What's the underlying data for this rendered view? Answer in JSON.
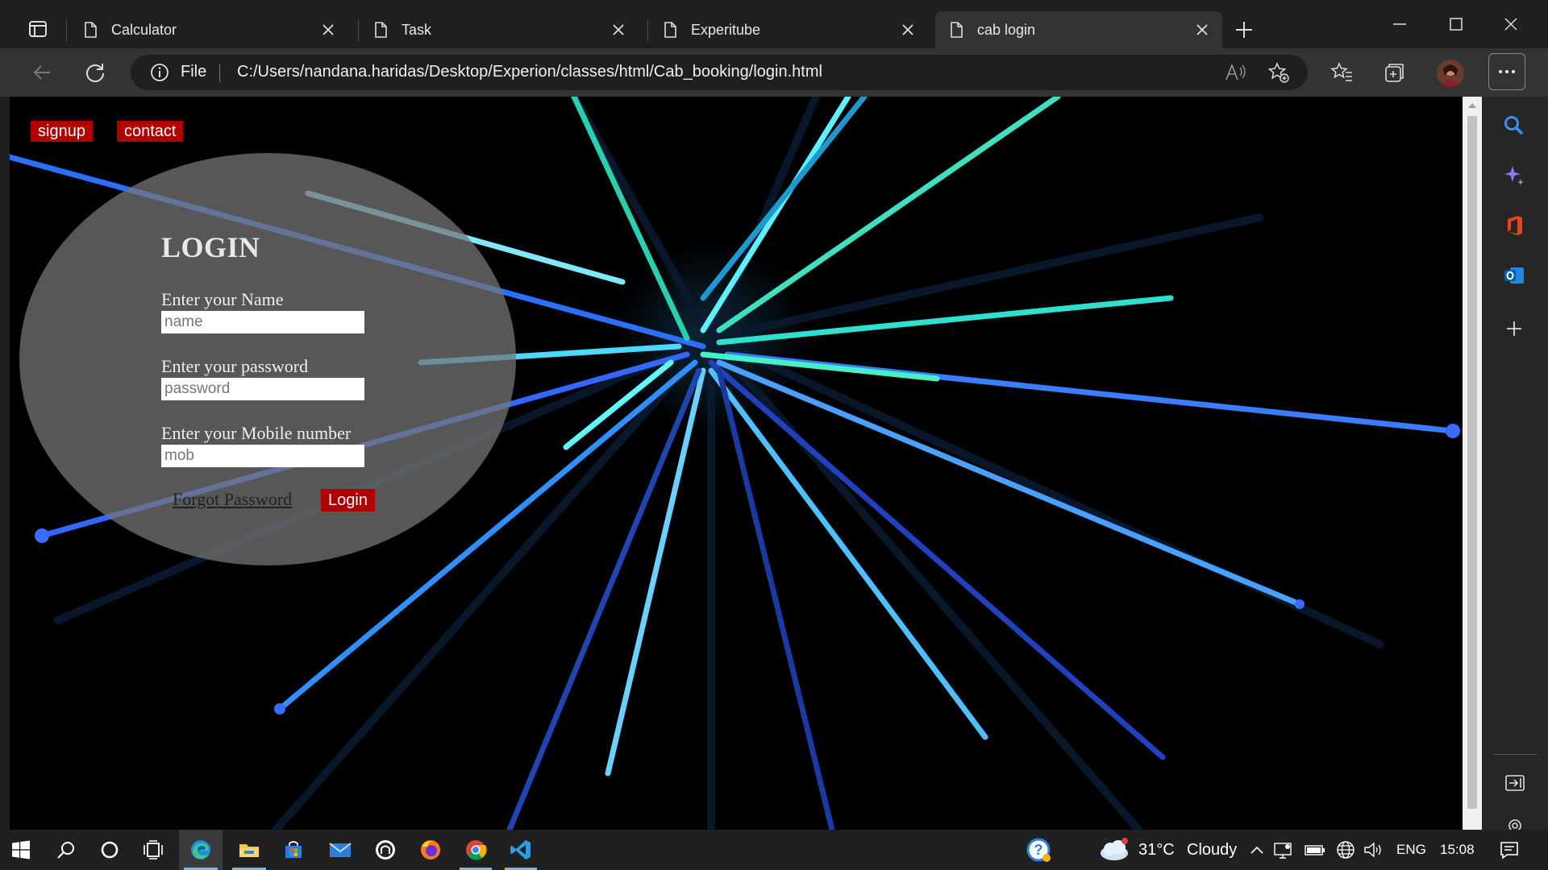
{
  "window": {
    "tabs": [
      {
        "label": "Calculator",
        "active": false
      },
      {
        "label": "Task",
        "active": false
      },
      {
        "label": "Experitube",
        "active": false
      },
      {
        "label": "cab login",
        "active": true
      }
    ]
  },
  "toolbar": {
    "scheme_label": "File",
    "url": "C:/Users/nandana.haridas/Desktop/Experion/classes/html/Cab_booking/login.html"
  },
  "page": {
    "nav": {
      "signup": "signup",
      "contact": "contact"
    },
    "form": {
      "title": "LOGIN",
      "name_label": "Enter your Name",
      "name_placeholder": "name",
      "password_label": "Enter your password",
      "password_placeholder": "password",
      "mobile_label": "Enter your Mobile number",
      "mobile_placeholder": "mob",
      "forgot_link": "Forgot Password",
      "login_button": "Login"
    }
  },
  "taskbar": {
    "weather": {
      "temp": "31°C",
      "condition": "Cloudy"
    },
    "language": "ENG",
    "time": "15:08"
  },
  "colors": {
    "accent_button": "#b30000",
    "browser_dark": "#202020",
    "toolbar_dark": "#333333"
  }
}
